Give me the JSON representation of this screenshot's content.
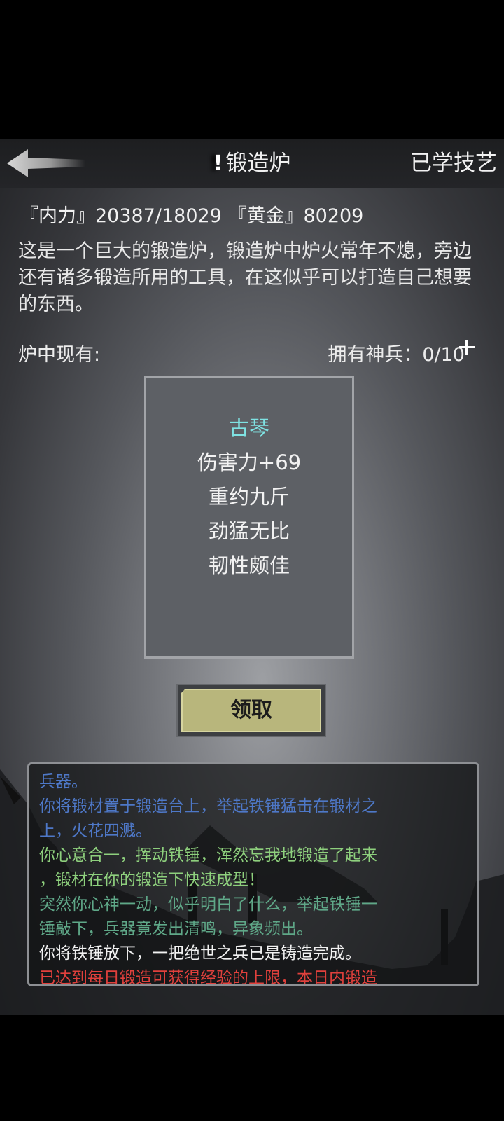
{
  "header": {
    "title_mark": "!",
    "title": "锻造炉",
    "skills_label": "已学技艺"
  },
  "stats": {
    "text": "『内力』20387/18029 『黄金』80209"
  },
  "description": "这是一个巨大的锻造炉，锻造炉中炉火常年不熄，旁边还有诸多锻造所用的工具，在这似乎可以打造自己想要的东西。",
  "furnace_label": "炉中现有:",
  "owned_weapons": "拥有神兵：0/10",
  "item": {
    "name": "古琴",
    "lines": [
      "伤害力+69",
      "重约九斤",
      "劲猛无比",
      "韧性颇佳"
    ]
  },
  "claim_label": "领取",
  "log": [
    {
      "text": "兵器。",
      "color": "#4e78c8"
    },
    {
      "text": "你将锻材置于锻造台上，举起铁锤猛击在锻材之",
      "color": "#4e78c8"
    },
    {
      "text": "上，火花四溅。",
      "color": "#4e78c8"
    },
    {
      "text": "你心意合一，挥动铁锤，浑然忘我地锻造了起来",
      "color": "#8ed07d"
    },
    {
      "text": "，锻材在你的锻造下快速成型！",
      "color": "#8ed07d"
    },
    {
      "text": "突然你心神一动，似乎明白了什么，举起铁锤一",
      "color": "#5fa888"
    },
    {
      "text": "锤敲下，兵器竟发出清鸣，异象频出。",
      "color": "#5fa888"
    },
    {
      "text": "你将铁锤放下，一把绝世之兵已是铸造完成。",
      "color": "#f2f2f2"
    },
    {
      "text": "已达到每日锻造可获得经验的上限，本日内锻造",
      "color": "#e0403c"
    }
  ],
  "colors": {
    "item_name": "#7fe3e3",
    "claim_button": "#b8b67c"
  },
  "icons": [
    "back-arrow-icon",
    "plus-icon"
  ]
}
